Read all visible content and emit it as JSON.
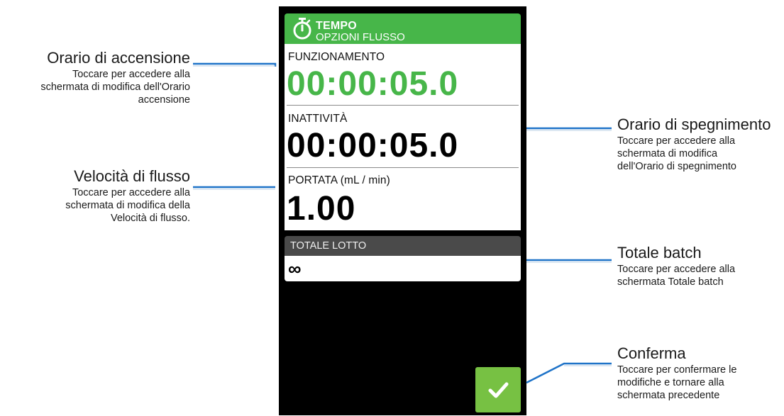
{
  "header": {
    "title": "TEMPO",
    "subtitle": "OPZIONI FLUSSO",
    "icon": "stopwatch-icon"
  },
  "sections": {
    "on_time": {
      "label": "FUNZIONAMENTO",
      "value": "00:00:05.0"
    },
    "off_time": {
      "label": "INATTIVITÀ",
      "value": "00:00:05.0"
    },
    "flow_rate": {
      "label": "PORTATA (mL / min)",
      "value": "1.00"
    }
  },
  "batch": {
    "label": "TOTALE LOTTO",
    "value": "∞"
  },
  "confirm": {
    "icon": "checkmark-icon"
  },
  "callouts": {
    "on_time": {
      "title": "Orario di accensione",
      "lines": [
        "Toccare per accedere alla",
        "schermata di modifica dell'Orario",
        "accensione"
      ]
    },
    "flow_rate": {
      "title": "Velocità di flusso",
      "lines": [
        "Toccare per accedere alla",
        "schermata di modifica della",
        "Velocità di flusso."
      ]
    },
    "off_time": {
      "title": "Orario di spegnimento",
      "lines": [
        "Toccare per accedere alla",
        "schermata di modifica",
        "dell'Orario di spegnimento"
      ]
    },
    "batch_total": {
      "title": "Totale batch",
      "lines": [
        "Toccare per accedere alla",
        "schermata Totale batch"
      ]
    },
    "confirm": {
      "title": "Conferma",
      "lines": [
        "Toccare per confermare le",
        "modifiche e tornare alla",
        "schermata precedente"
      ]
    }
  },
  "colors": {
    "header_green": "#47b649",
    "on_time_value": "#47b649",
    "confirm_button": "#77c143",
    "batch_header": "#4a4a4a",
    "leader_line": "#1f73c8"
  }
}
